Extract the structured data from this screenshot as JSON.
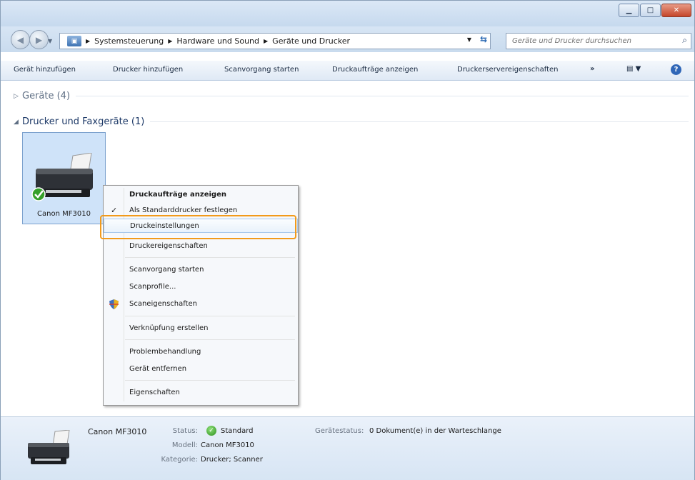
{
  "window": {
    "minimize_icon": "minimize-icon",
    "maximize_icon": "maximize-icon",
    "close_icon": "close-icon"
  },
  "address": {
    "crumbs": [
      "Systemsteuerung",
      "Hardware und Sound",
      "Geräte und Drucker"
    ],
    "search_placeholder": "Geräte und Drucker durchsuchen"
  },
  "commands": {
    "add_device": "Gerät hinzufügen",
    "add_printer": "Drucker hinzufügen",
    "start_scan": "Scanvorgang starten",
    "show_jobs": "Druckaufträge anzeigen",
    "server_props": "Druckerservereigenschaften",
    "more": "»"
  },
  "groups": {
    "devices": "Geräte (4)",
    "printers": "Drucker und Faxgeräte (1)"
  },
  "device": {
    "name": "Canon MF3010"
  },
  "context_menu": {
    "items": [
      "Druckaufträge anzeigen",
      "Als Standarddrucker festlegen",
      "Druckeinstellungen",
      "Druckereigenschaften",
      "Scanvorgang starten",
      "Scanprofile...",
      "Scaneigenschaften",
      "Verknüpfung erstellen",
      "Problembehandlung",
      "Gerät entfernen",
      "Eigenschaften"
    ]
  },
  "details": {
    "name": "Canon MF3010",
    "status_label": "Status:",
    "status_value": "Standard",
    "model_label": "Modell:",
    "model_value": "Canon MF3010",
    "category_label": "Kategorie:",
    "category_value": "Drucker; Scanner",
    "device_status_label": "Gerätestatus:",
    "device_status_value": "0 Dokument(e) in der Warteschlange"
  },
  "colors": {
    "accent": "#f29a1a",
    "selection": "#cfe3f9",
    "ok": "#2b8f1c"
  }
}
